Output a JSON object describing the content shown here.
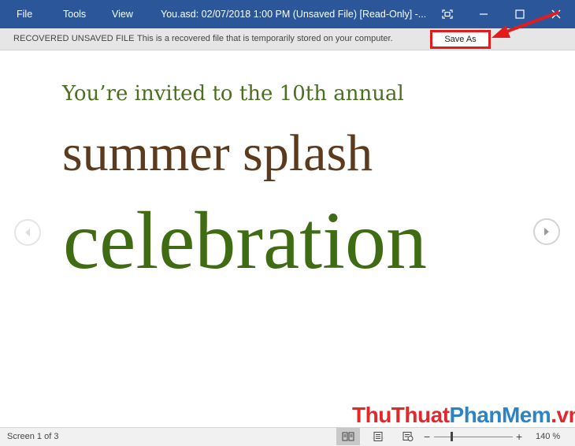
{
  "titlebar": {
    "menu": [
      "File",
      "Tools",
      "View"
    ],
    "title": "You.asd: 02/07/2018 1:00 PM (Unsaved File) [Read-Only] -..."
  },
  "message_bar": {
    "label": "RECOVERED UNSAVED FILE",
    "message": "This is a recovered file that is temporarily stored on your computer.",
    "save_as": "Save As"
  },
  "document": {
    "line1": "You’re invited to the 10th annual",
    "line2": "summer splash",
    "line3": "celebration"
  },
  "watermark": {
    "part1": "ThuThuat",
    "part2": "PhanMem",
    "part3": ".vn"
  },
  "status": {
    "page": "Screen 1 of 3",
    "zoom": "140 %",
    "zoom_minus": "−",
    "zoom_plus": "+",
    "zoom_slider_fraction": 0.22
  },
  "colors": {
    "titlebar": "#2b579a",
    "highlight": "#e31b1b",
    "line1": "#4a6f1e",
    "line2": "#5b3a1e",
    "line3": "#3f6b12"
  }
}
